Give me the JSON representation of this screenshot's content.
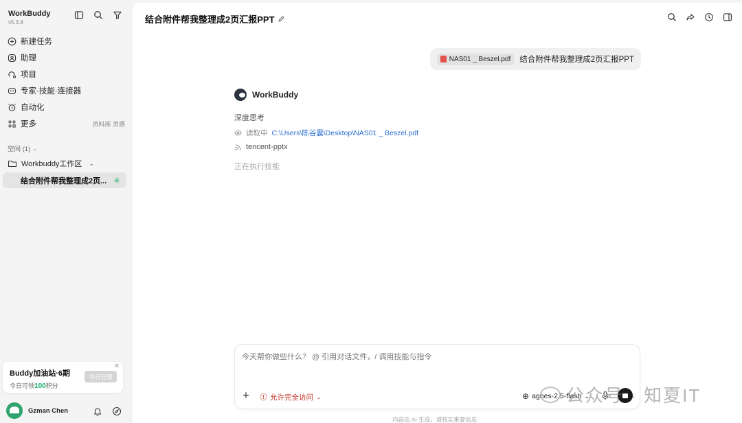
{
  "app": {
    "name": "WorkBuddy",
    "version": "v5.3.8"
  },
  "sidebar": {
    "nav": [
      {
        "label": "新建任务",
        "icon": "plus-circle-icon"
      },
      {
        "label": "助理",
        "icon": "assistant-icon"
      },
      {
        "label": "项目",
        "icon": "project-icon"
      },
      {
        "label": "专家·技能·连接器",
        "icon": "expert-icon"
      },
      {
        "label": "自动化",
        "icon": "alarm-icon"
      },
      {
        "label": "更多",
        "icon": "grid-icon",
        "extra": "资料库 灵感"
      }
    ],
    "space_label": "空间 (1)",
    "workspace": "Workbuddy工作区",
    "task": "结合附件帮我整理成2页..."
  },
  "promo": {
    "title": "Buddy加油站·6期",
    "sub_prefix": "今日可领",
    "sub_points": "100",
    "sub_suffix": "积分",
    "button": "今日已领"
  },
  "user": {
    "name": "Gzman Chen"
  },
  "main": {
    "title": "结合附件帮我整理成2页汇报PPT",
    "user_message": {
      "file": "NAS01 _ Beszel.pdf",
      "text": "结合附件帮我整理成2页汇报PPT"
    },
    "assistant": {
      "name": "WorkBuddy",
      "thinking": "深度思考",
      "reading_label": "读取中",
      "reading_path": "C:\\Users\\陈谷震\\Desktop\\NAS01 _ Beszel.pdf",
      "skill": "tencent-pptx",
      "status": "正在执行技能"
    },
    "composer": {
      "placeholder": "今天帮你做些什么？ @ 引用对话文件，/ 调用技能与指令",
      "access": "允许完全访问",
      "model": "agnes-2.5-flash"
    },
    "disclaimer": "内容由 AI 生成，请核实重要信息",
    "watermark": "公众号 · 知夏IT"
  }
}
